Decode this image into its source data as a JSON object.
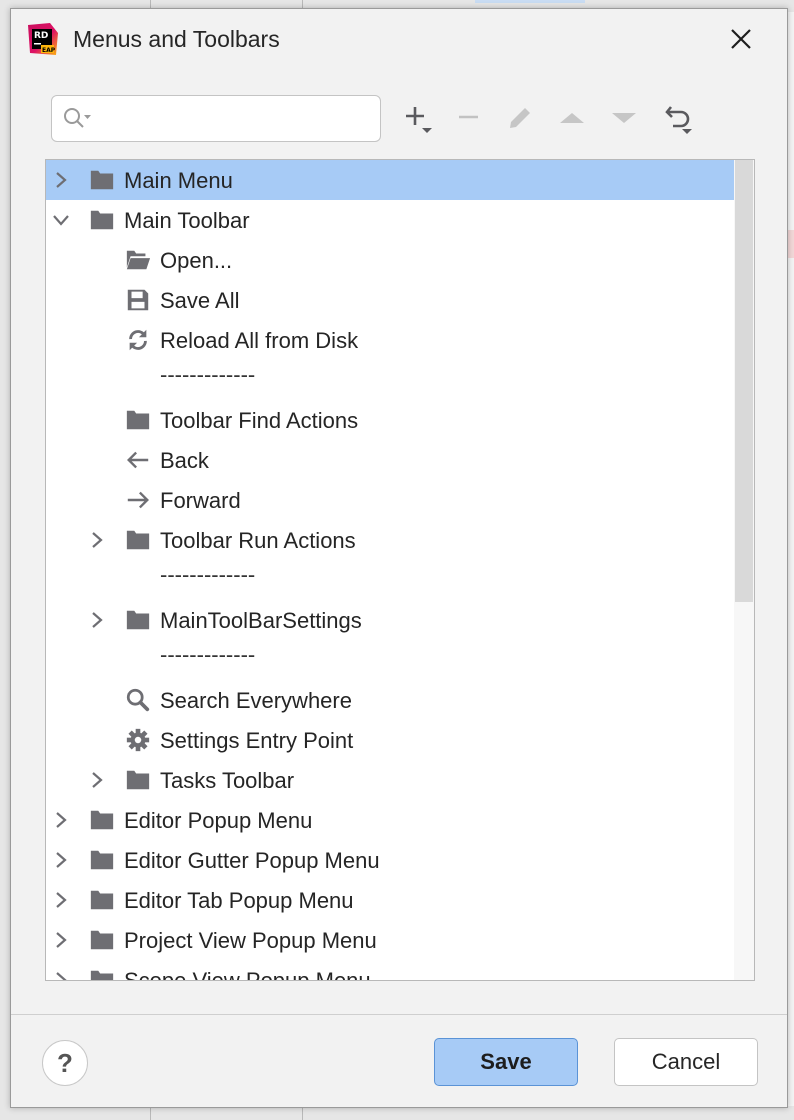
{
  "dialog": {
    "title": "Menus and Toolbars",
    "app_icon_label": "RD",
    "app_icon_sublabel": "EAP"
  },
  "search": {
    "placeholder": "",
    "value": ""
  },
  "toolbar": [
    "add-icon",
    "remove-icon",
    "edit-icon",
    "move-up-icon",
    "move-down-icon",
    "restore-icon"
  ],
  "tree": [
    {
      "label": "Main Menu",
      "level": 0,
      "arrow": "right",
      "icon": "folder-icon",
      "selected": true
    },
    {
      "label": "Main Toolbar",
      "level": 0,
      "arrow": "down",
      "icon": "folder-icon"
    },
    {
      "label": "Open...",
      "level": 1,
      "arrow": "",
      "icon": "open-folder-icon"
    },
    {
      "label": "Save All",
      "level": 1,
      "arrow": "",
      "icon": "save-icon"
    },
    {
      "label": "Reload All from Disk",
      "level": 1,
      "arrow": "",
      "icon": "reload-icon"
    },
    {
      "label": "-------------",
      "level": 1,
      "separator": true
    },
    {
      "label": "Toolbar Find Actions",
      "level": 1,
      "arrow": "",
      "icon": "folder-icon"
    },
    {
      "label": "Back",
      "level": 1,
      "arrow": "",
      "icon": "back-arrow-icon"
    },
    {
      "label": "Forward",
      "level": 1,
      "arrow": "",
      "icon": "forward-arrow-icon"
    },
    {
      "label": "Toolbar Run Actions",
      "level": 1,
      "arrow": "right",
      "icon": "folder-icon"
    },
    {
      "label": "-------------",
      "level": 1,
      "separator": true
    },
    {
      "label": "MainToolBarSettings",
      "level": 1,
      "arrow": "right",
      "icon": "folder-icon"
    },
    {
      "label": "-------------",
      "level": 1,
      "separator": true
    },
    {
      "label": "Search Everywhere",
      "level": 1,
      "arrow": "",
      "icon": "search-icon"
    },
    {
      "label": "Settings Entry Point",
      "level": 1,
      "arrow": "",
      "icon": "gear-icon"
    },
    {
      "label": "Tasks Toolbar",
      "level": 1,
      "arrow": "right",
      "icon": "folder-icon"
    },
    {
      "label": "Editor Popup Menu",
      "level": 0,
      "arrow": "right",
      "icon": "folder-icon"
    },
    {
      "label": "Editor Gutter Popup Menu",
      "level": 0,
      "arrow": "right",
      "icon": "folder-icon"
    },
    {
      "label": "Editor Tab Popup Menu",
      "level": 0,
      "arrow": "right",
      "icon": "folder-icon"
    },
    {
      "label": "Project View Popup Menu",
      "level": 0,
      "arrow": "right",
      "icon": "folder-icon"
    },
    {
      "label": "Scope View Popup Menu",
      "level": 0,
      "arrow": "right",
      "icon": "folder-icon"
    }
  ],
  "footer": {
    "help_label": "?",
    "save_label": "Save",
    "cancel_label": "Cancel"
  },
  "colors": {
    "selection": "#a7cbf6",
    "icon_gray": "#6e6e73",
    "primary_button": "#a7cbf6"
  }
}
